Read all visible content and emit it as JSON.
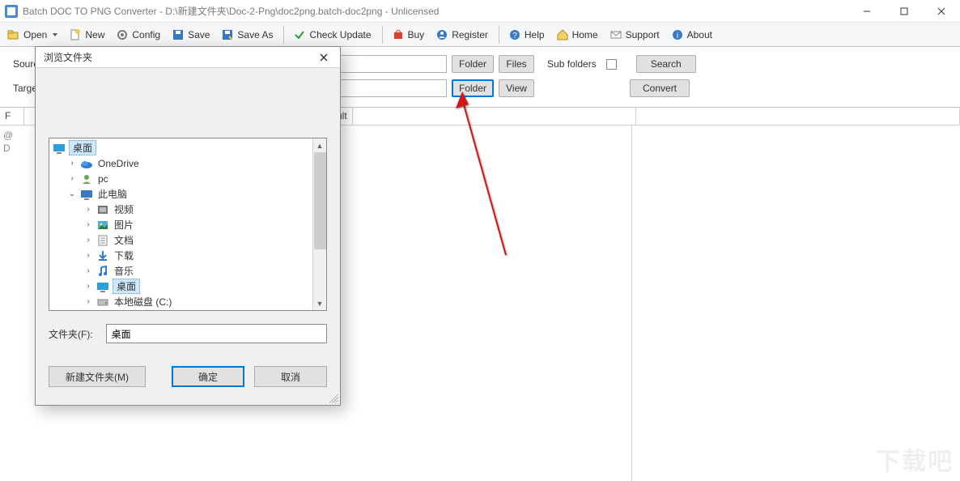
{
  "window": {
    "title": "Batch DOC TO PNG Converter - D:\\新建文件夹\\Doc-2-Png\\doc2png.batch-doc2png - Unlicensed"
  },
  "toolbar": {
    "open": "Open",
    "new": "New",
    "config": "Config",
    "save": "Save",
    "save_as": "Save As",
    "check_update": "Check Update",
    "buy": "Buy",
    "register": "Register",
    "help": "Help",
    "home": "Home",
    "support": "Support",
    "about": "About"
  },
  "form": {
    "source_label": "Sourc",
    "target_label": "Targe",
    "folder_btn": "Folder",
    "files_btn": "Files",
    "view_btn": "View",
    "sub_folders": "Sub folders",
    "search_btn": "Search",
    "convert_btn": "Convert"
  },
  "grid": {
    "left_sym1": "@",
    "left_sym2": "D",
    "col1": "F",
    "col2": "ult"
  },
  "dialog": {
    "title": "浏览文件夹",
    "root": "桌面",
    "items": [
      {
        "arrow": "›",
        "icon": "onedrive",
        "label": "OneDrive",
        "indent": 1
      },
      {
        "arrow": "›",
        "icon": "user",
        "label": "pc",
        "indent": 1
      },
      {
        "arrow": "v",
        "icon": "pc",
        "label": "此电脑",
        "indent": 1
      },
      {
        "arrow": "›",
        "icon": "video",
        "label": "视频",
        "indent": 2
      },
      {
        "arrow": "›",
        "icon": "picture",
        "label": "图片",
        "indent": 2
      },
      {
        "arrow": "›",
        "icon": "doc",
        "label": "文档",
        "indent": 2
      },
      {
        "arrow": "›",
        "icon": "download",
        "label": "下载",
        "indent": 2
      },
      {
        "arrow": "›",
        "icon": "music",
        "label": "音乐",
        "indent": 2
      },
      {
        "arrow": "›",
        "icon": "desktop",
        "label": "桌面",
        "indent": 2,
        "selected": true
      },
      {
        "arrow": "›",
        "icon": "drive",
        "label": "本地磁盘 (C:)",
        "indent": 2
      }
    ],
    "field_label": "文件夹(F):",
    "field_value": "桌面",
    "btn_new": "新建文件夹(M)",
    "btn_ok": "确定",
    "btn_cancel": "取消"
  },
  "watermark": "下载吧"
}
